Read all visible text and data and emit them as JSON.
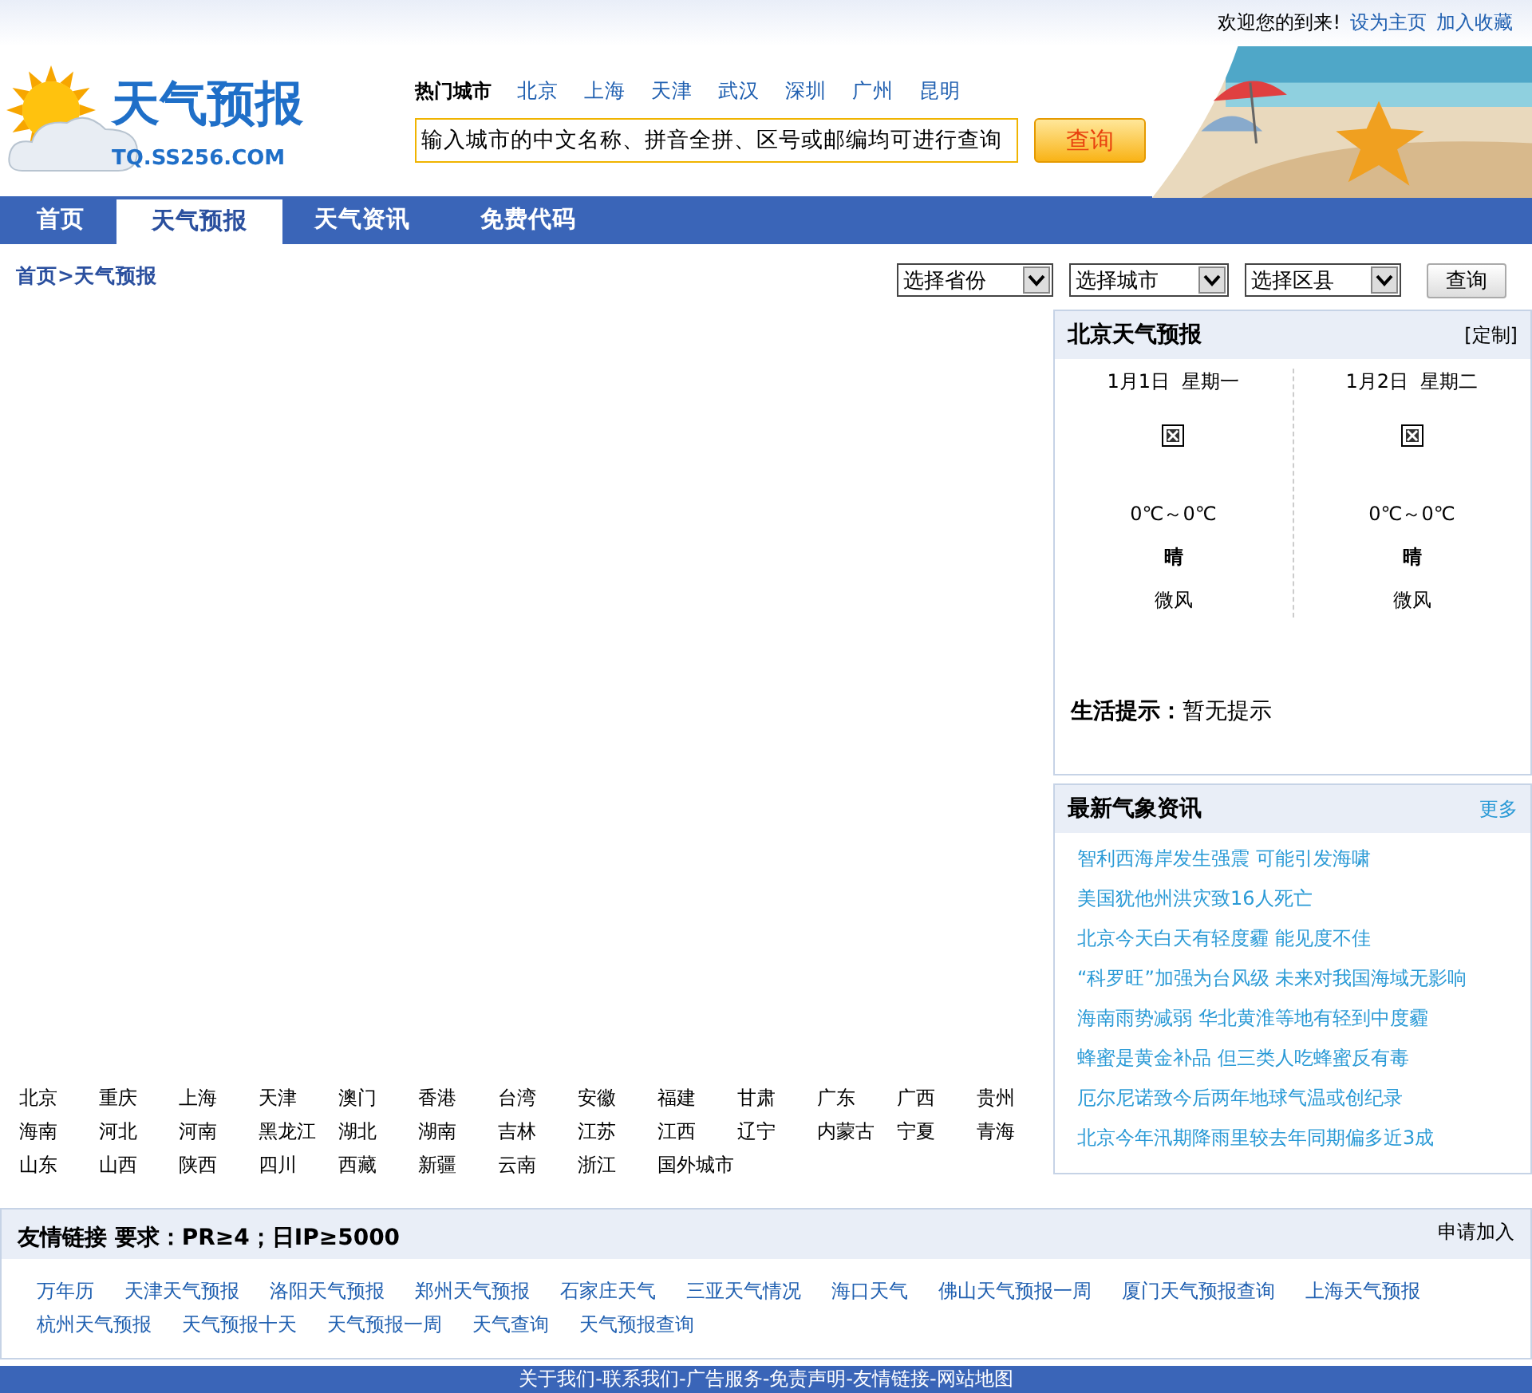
{
  "top_bar": {
    "welcome": "欢迎您的到来!",
    "links": [
      "设为主页",
      "加入收藏"
    ]
  },
  "logo": {
    "title": "天气预报",
    "domain": "TQ.SS256.COM"
  },
  "hot_cities": {
    "label": "热门城市",
    "cities": [
      "北京",
      "上海",
      "天津",
      "武汉",
      "深圳",
      "广州",
      "昆明"
    ]
  },
  "search": {
    "value": "输入城市的中文名称、拼音全拼、区号或邮编均可进行查询",
    "button": "查询"
  },
  "header_image": {
    "kind": "picture"
  },
  "nav": [
    {
      "label": "首页",
      "selected": false
    },
    {
      "label": "天气预报",
      "selected": true
    },
    {
      "label": "天气资讯",
      "selected": false
    },
    {
      "label": "免费代码",
      "selected": false
    }
  ],
  "breadcrumb": [
    "首页",
    ">",
    "天气预报"
  ],
  "selectors": {
    "dropdowns": [
      "选择省份",
      "选择城市",
      "选择区县"
    ],
    "button": "查询"
  },
  "forecast": {
    "title": "北京天气预报",
    "action": "[定制]",
    "days": [
      {
        "date": "1月1日  星期一",
        "temp": "0℃～0℃",
        "weather": "晴",
        "wind": "微风"
      },
      {
        "date": "1月2日  星期二",
        "temp": "0℃～0℃",
        "weather": "晴",
        "wind": "微风"
      }
    ],
    "tip_label": "生活提示：",
    "tip": "暂无提示"
  },
  "news": {
    "title": "最新气象资讯",
    "more": "更多",
    "items": [
      "智利西海岸发生强震 可能引发海啸",
      "美国犹他州洪灾致16人死亡",
      "北京今天白天有轻度霾 能见度不佳",
      "“科罗旺”加强为台风级 未来对我国海域无影响",
      "海南雨势减弱 华北黄淮等地有轻到中度霾",
      "蜂蜜是黄金补品 但三类人吃蜂蜜反有毒",
      "厄尔尼诺致今后两年地球气温或创纪录",
      "北京今年汛期降雨里较去年同期偏多近3成"
    ]
  },
  "provinces": [
    "北京",
    "重庆",
    "上海",
    "天津",
    "澳门",
    "香港",
    "台湾",
    "安徽",
    "福建",
    "甘肃",
    "广东",
    "广西",
    "贵州",
    "海南",
    "河北",
    "河南",
    "黑龙江",
    "湖北",
    "湖南",
    "吉林",
    "江苏",
    "江西",
    "辽宁",
    "内蒙古",
    "宁夏",
    "青海",
    "山东",
    "山西",
    "陕西",
    "四川",
    "西藏",
    "新疆",
    "云南",
    "浙江",
    "国外城市"
  ],
  "friend_links": {
    "title": "友情链接 要求：PR≥4；日IP≥5000",
    "apply": "申请加入",
    "links": [
      "万年历",
      "天津天气预报",
      "洛阳天气预报",
      "郑州天气预报",
      "石家庄天气",
      "三亚天气情况",
      "海口天气",
      "佛山天气预报一周",
      "厦门天气预报查询",
      "上海天气预报",
      "杭州天气预报",
      "天气预报十天",
      "天气预报一周",
      "天气查询",
      "天气预报查询"
    ]
  },
  "footer": "关于我们-联系我们-广告服务-免责声明-友情链接-网站地图"
}
